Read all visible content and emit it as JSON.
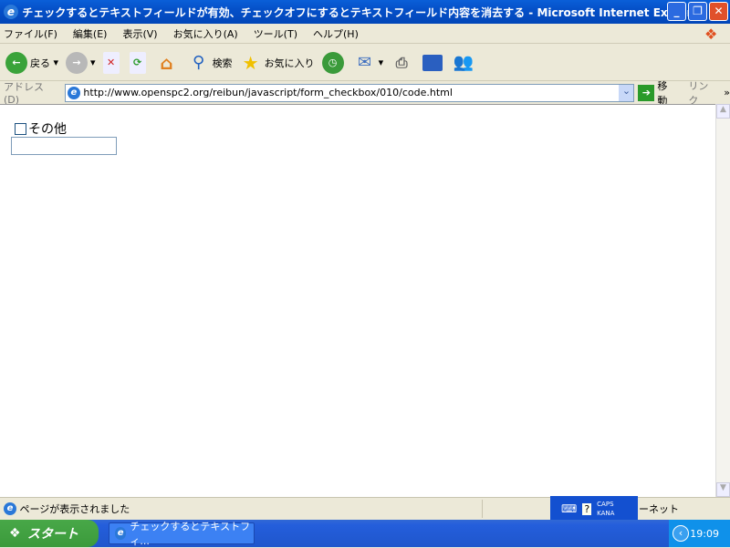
{
  "window": {
    "title": "チェックするとテキストフィールドが有効、チェックオフにするとテキストフィールド内容を消去する - Microsoft Internet Explorer",
    "minimize": "_",
    "restore": "❐",
    "close": "✕"
  },
  "menu": [
    "ファイル(F)",
    "編集(E)",
    "表示(V)",
    "お気に入り(A)",
    "ツール(T)",
    "ヘルプ(H)"
  ],
  "toolbar": {
    "back": "戻る",
    "search": "検索",
    "favorites": "お気に入り"
  },
  "address": {
    "label": "アドレス(D)",
    "url": "http://www.openspc2.org/reibun/javascript/form_checkbox/010/code.html",
    "go": "移動",
    "links": "リンク"
  },
  "page": {
    "checkbox_label": "その他",
    "checked": false,
    "text_value": ""
  },
  "status": {
    "text": "ページが表示されました",
    "zone": "ーネット"
  },
  "ime": {
    "caps": "CAPS",
    "kana": "KANA"
  },
  "taskbar": {
    "start": "スタート",
    "task": "チェックするとテキストフィ...",
    "clock": "19:09"
  }
}
